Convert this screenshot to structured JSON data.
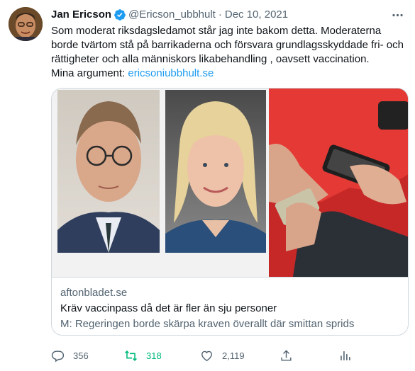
{
  "tweet": {
    "author_name": "Jan Ericson",
    "handle": "@Ericson_ubbhult",
    "separator": "·",
    "date": "Dec 10, 2021",
    "text_lines": [
      "Som moderat riksdagsledamot står  jag inte bakom detta. Moderaterna",
      "borde tvärtom stå på barrikaderna och försvara grundlagsskyddade fri- och",
      "rättigheter och alla människors  likabehandling , oavsett vaccination."
    ],
    "text_prefix": "Mina argument: ",
    "text_link": "ericsoniubbhult.se",
    "colors": {
      "link": "#1d9bf0",
      "verified": "#1d9bf0",
      "retweet_active": "#00ba7c",
      "muted": "#536471"
    }
  },
  "card": {
    "domain": "aftonbladet.se",
    "title": "Kräv vaccinpass då det är fler än sju personer",
    "description": "M: Regeringen borde skärpa kraven överallt där smittan sprids"
  },
  "actions": {
    "reply_count": "356",
    "retweet_count": "318",
    "like_count": "2,119",
    "icons": [
      "reply-icon",
      "retweet-icon",
      "like-icon",
      "share-icon",
      "analytics-icon"
    ]
  }
}
